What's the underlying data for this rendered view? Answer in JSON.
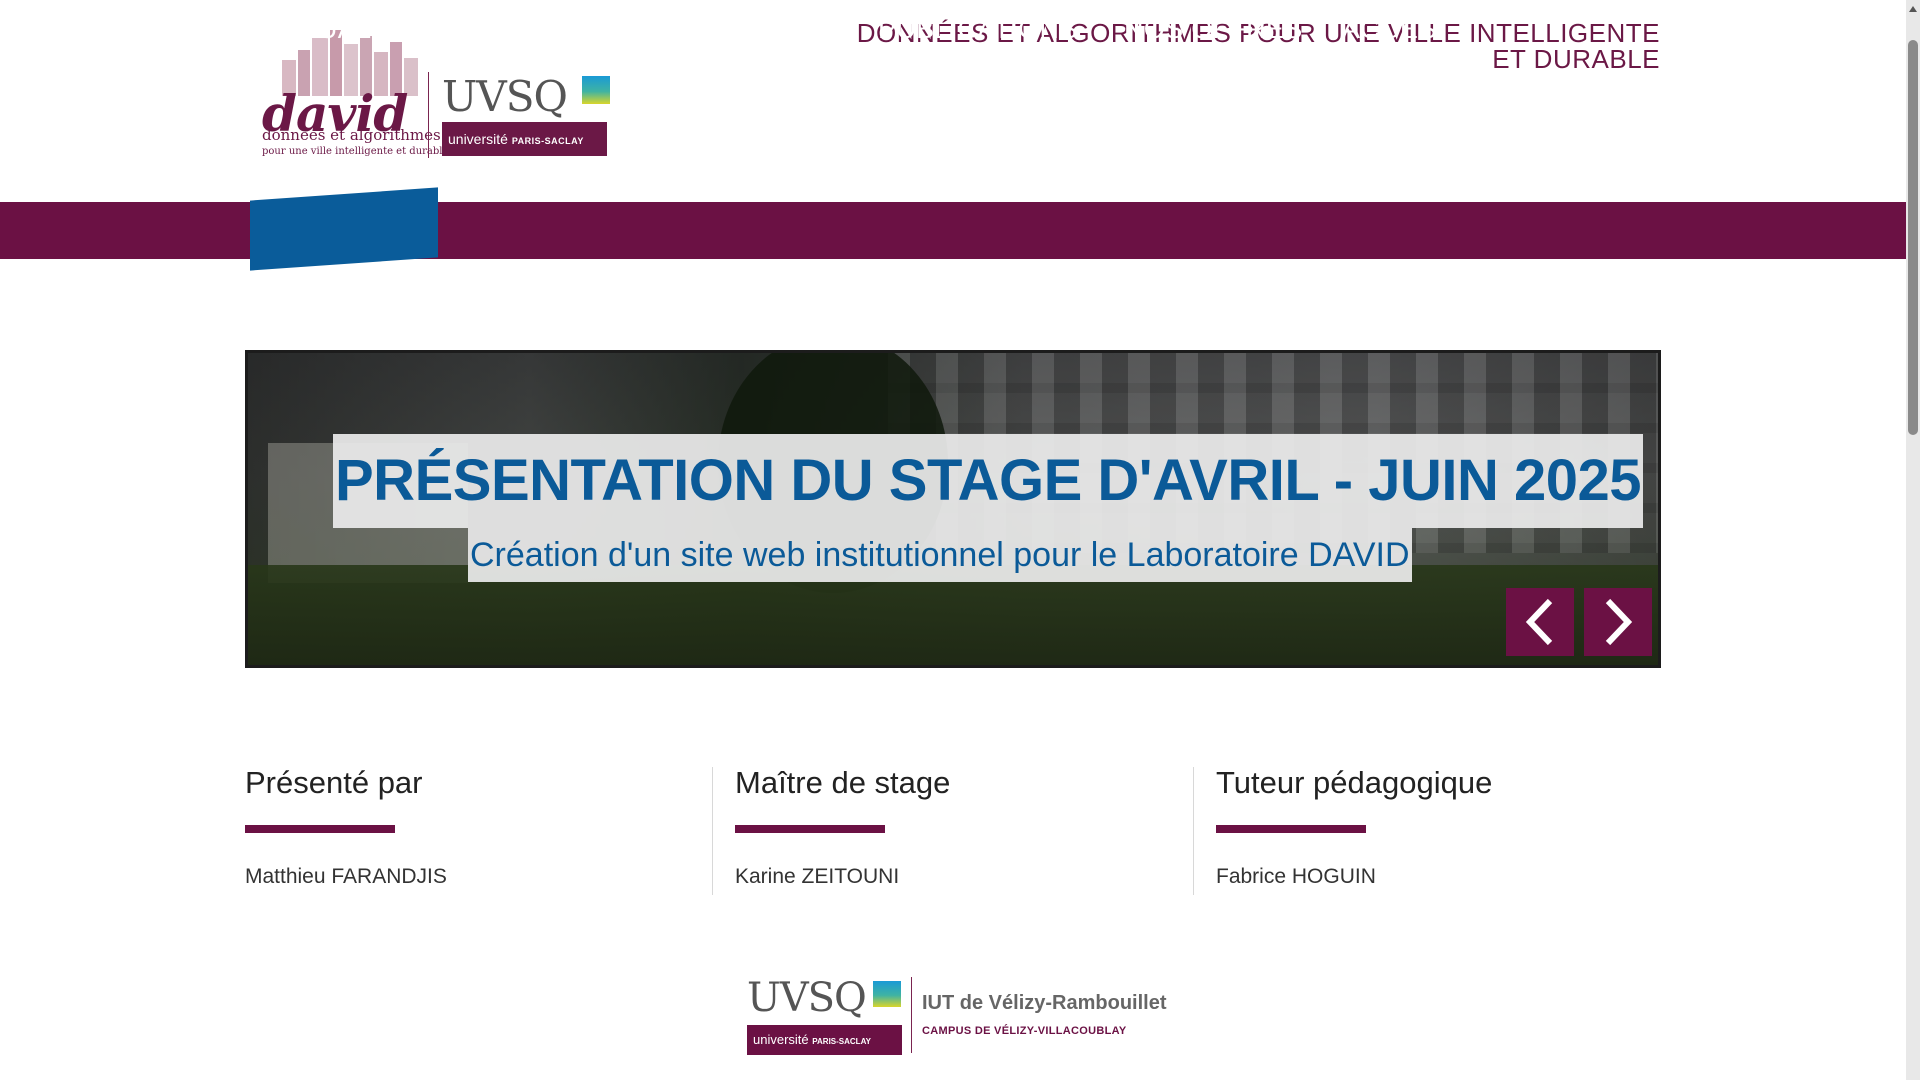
{
  "header": {
    "site_title_line1": "DONNÉES ET ALGORITHMES POUR UNE VILLE INTELLIGENTE",
    "site_title_line2": "ET DURABLE",
    "david_logo": {
      "word": "david",
      "tagline1": "données et algorithmes",
      "tagline2": "pour une ville intelligente et durable"
    },
    "uvsq_logo": {
      "word": "UVSQ",
      "badge_main": "université",
      "badge_small": "PARIS-SACLAY"
    }
  },
  "nav": {
    "items": [
      {
        "label": "ACTUALITÉS",
        "active": true
      },
      {
        "label": "LABORATOIRE",
        "active": false
      },
      {
        "label": "EQUIPES",
        "active": false
      },
      {
        "label": "PUBLICATIONS",
        "active": false
      },
      {
        "label": "NOS OFFRES",
        "active": false
      },
      {
        "label": "ACCÈS",
        "active": false
      }
    ],
    "active_color": "#0a5c9a",
    "bar_color": "#6b1144"
  },
  "hero": {
    "title": "PRÉSENTATION DU STAGE D'AVRIL - JUIN 2025",
    "subtitle": "Création d'un site web institutionnel pour le Laboratoire DAVID",
    "prev_icon": "chevron-left-icon",
    "next_icon": "chevron-right-icon",
    "text_color": "#0b5a98"
  },
  "info": {
    "columns": [
      {
        "title": "Présenté par",
        "name": "Matthieu FARANDJIS"
      },
      {
        "title": "Maître de stage",
        "name": "Karine ZEITOUNI"
      },
      {
        "title": "Tuteur pédagogique",
        "name": "Fabrice HOGUIN"
      }
    ]
  },
  "footer": {
    "uvsq_word": "UVSQ",
    "badge_main": "université",
    "badge_small": "PARIS-SACLAY",
    "iut_name": "IUT de Vélizy-Rambouillet",
    "campus": "CAMPUS DE VÉLIZY-VILLACOUBLAY"
  },
  "colors": {
    "brand": "#6b1144",
    "accent_blue": "#0a5c9a"
  }
}
